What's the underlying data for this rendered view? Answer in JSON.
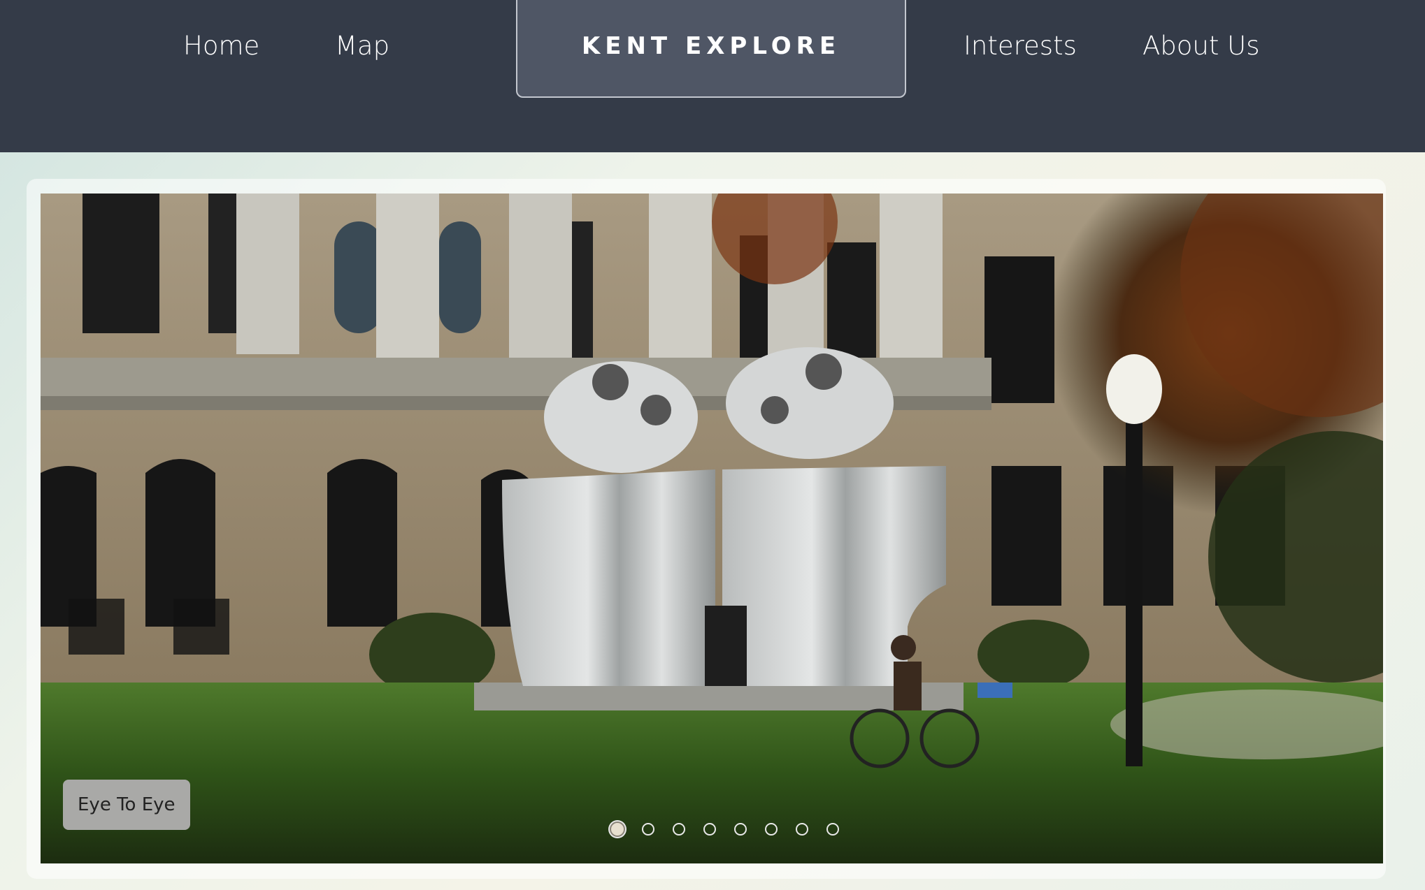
{
  "nav": {
    "left_links": [
      {
        "label": "Home"
      },
      {
        "label": "Map"
      }
    ],
    "brand": "KENT EXPLORE",
    "right_links": [
      {
        "label": "Interests"
      },
      {
        "label": "About Us"
      }
    ]
  },
  "carousel": {
    "caption": "Eye To Eye",
    "slide_count": 8,
    "active_index": 0,
    "image": "photo of the Eye To Eye stainless steel sculpture in front of a columned brick building with a cyclist riding past on the grass"
  },
  "colors": {
    "nav_background": "#343b48",
    "brand_box": "#4f5665",
    "caption_background": "#a9a9a7"
  }
}
